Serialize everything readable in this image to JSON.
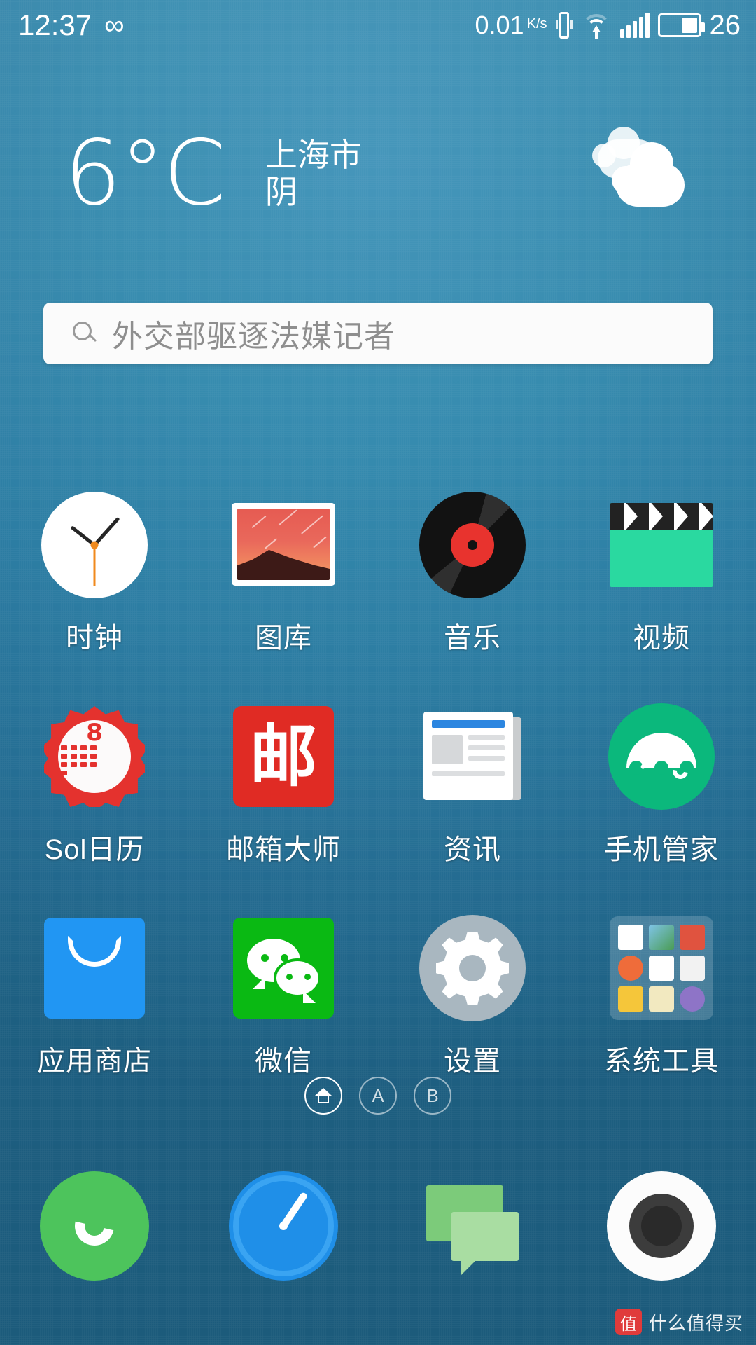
{
  "status_bar": {
    "time": "12:37",
    "infinity_icon": "∞",
    "network_speed": "0.01",
    "network_speed_unit_num": "K",
    "network_speed_unit_den": "s",
    "vibrate_icon": "vibrate-icon",
    "wifi_icon": "wifi-icon",
    "signal_icon": "cellular-signal-icon",
    "battery_icon": "battery-icon",
    "battery_percent": "26"
  },
  "weather": {
    "temperature": "6°C",
    "city": "上海市",
    "condition": "阴",
    "icon": "overcast-clouds-icon"
  },
  "search": {
    "icon": "search-icon",
    "query": "外交部驱逐法媒记者"
  },
  "apps": [
    {
      "label": "时钟",
      "icon": "clock-icon"
    },
    {
      "label": "图库",
      "icon": "gallery-icon"
    },
    {
      "label": "音乐",
      "icon": "music-vinyl-icon"
    },
    {
      "label": "视频",
      "icon": "video-clapperboard-icon"
    },
    {
      "label": "Sol日历",
      "icon": "calendar-sunburst-icon",
      "badge": "8"
    },
    {
      "label": "邮箱大师",
      "icon": "mail-icon",
      "glyph": "邮"
    },
    {
      "label": "资讯",
      "icon": "news-icon"
    },
    {
      "label": "手机管家",
      "icon": "umbrella-security-icon"
    },
    {
      "label": "应用商店",
      "icon": "app-store-bag-icon"
    },
    {
      "label": "微信",
      "icon": "wechat-icon"
    },
    {
      "label": "设置",
      "icon": "gear-icon"
    },
    {
      "label": "系统工具",
      "icon": "folder-icon"
    }
  ],
  "page_indicator": {
    "pages": [
      {
        "label": "",
        "icon": "home-icon",
        "active": true
      },
      {
        "label": "A",
        "icon": "page-a-icon",
        "active": false
      },
      {
        "label": "B",
        "icon": "page-b-icon",
        "active": false
      }
    ]
  },
  "dock": [
    {
      "name": "phone",
      "icon": "phone-icon"
    },
    {
      "name": "browser",
      "icon": "compass-browser-icon"
    },
    {
      "name": "messages",
      "icon": "messages-icon"
    },
    {
      "name": "camera",
      "icon": "camera-icon"
    }
  ],
  "watermark": {
    "badge": "值",
    "text": "什么值得买"
  },
  "colors": {
    "wallpaper_top": "#3c8fb6",
    "wallpaper_bottom": "#1b5a7e",
    "accent_red": "#e4322e",
    "accent_green": "#0ab913",
    "accent_blue": "#2196f3",
    "search_bg": "#fbfbfb"
  }
}
